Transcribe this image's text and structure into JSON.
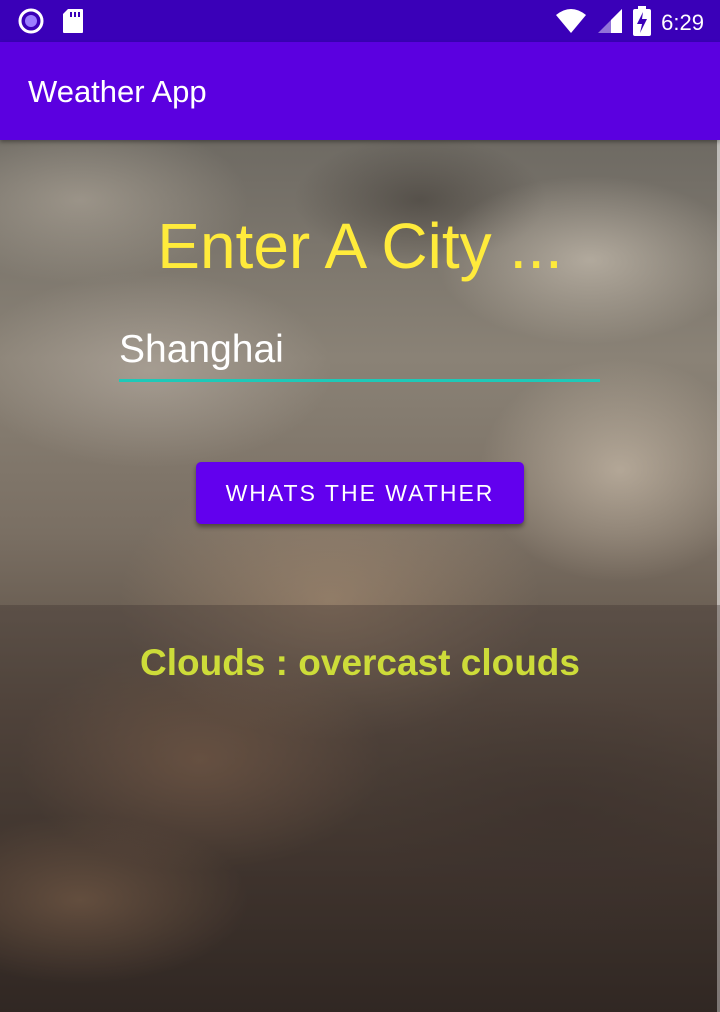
{
  "status_bar": {
    "time": "6:29",
    "icons": [
      "app-notification-icon",
      "sd-card-icon",
      "wifi-icon",
      "cell-signal-icon",
      "battery-charging-icon"
    ]
  },
  "app_bar": {
    "title": "Weather App"
  },
  "main": {
    "heading": "Enter A City ...",
    "city_input_value": "Shanghai",
    "button_label": "WHATS THE WATHER",
    "result_text": "Clouds : overcast clouds"
  },
  "colors": {
    "status_bar": "#3a00b8",
    "app_bar": "#5b00e0",
    "button": "#6200ee",
    "heading": "#ffeb3b",
    "input_underline": "#1ec9b8",
    "result_text": "#cddc39"
  }
}
